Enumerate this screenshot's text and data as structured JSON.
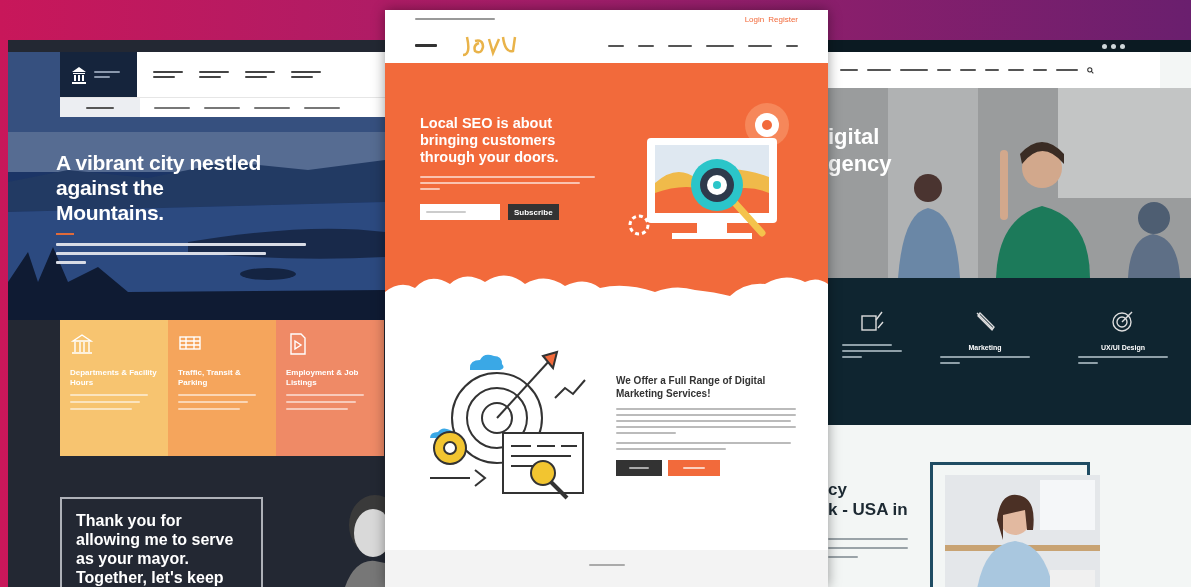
{
  "left_site": {
    "hero": {
      "headline_lines": [
        "A vibrant city nestled",
        "against the",
        "Mountains."
      ]
    },
    "cards": [
      {
        "title": "Departments & Facility Hours",
        "color": "#f7c470"
      },
      {
        "title": "Traffic, Transit & Parking",
        "color": "#f5a55c"
      },
      {
        "title": "Employment & Job Listings",
        "color": "#ef8a66"
      }
    ],
    "quote_lines": [
      "Thank you for",
      "allowing me to serve",
      "as your mayor.",
      "Together, let's keep"
    ]
  },
  "middle_site": {
    "top_links": [
      "Login",
      "Register"
    ],
    "hero": {
      "headline_lines": [
        "Local SEO is about",
        "bringing customers",
        "through your doors."
      ],
      "subscribe_button": "Subscribe"
    },
    "services": {
      "headline_lines": [
        "We Offer a Full Range of Digital",
        "Marketing Services!"
      ]
    }
  },
  "right_site": {
    "hero": {
      "headline_lines": [
        "igital",
        "gency"
      ]
    },
    "services": [
      {
        "title": "Marketing"
      },
      {
        "title": "UX/UI Design"
      }
    ],
    "about": {
      "headline_lines": [
        "cy",
        "k - USA in"
      ]
    }
  }
}
